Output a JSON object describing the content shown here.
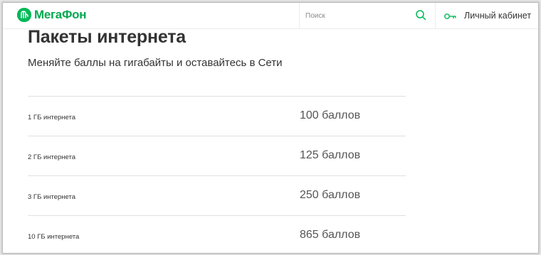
{
  "header": {
    "logo": {
      "mark": "Ⓜ",
      "text": "МегаФон"
    },
    "search": {
      "placeholder": "Поиск",
      "icon": "search-icon"
    },
    "cabinet": {
      "icon": "key-icon",
      "label": "Личный кабинет"
    }
  },
  "main": {
    "title": "Пакеты интернета",
    "subtitle": "Меняйте баллы на гигабайты и оставайтесь в Сети",
    "packages": [
      {
        "name": "1 ГБ интернета",
        "price": "100 баллов"
      },
      {
        "name": "2 ГБ интернета",
        "price": "125 баллов"
      },
      {
        "name": "3 ГБ интернета",
        "price": "250 баллов"
      },
      {
        "name": "10 ГБ интернета",
        "price": "865 баллов"
      }
    ]
  },
  "colors": {
    "brand": "#00b956",
    "text": "#333333",
    "divider": "#e0e0e0"
  }
}
